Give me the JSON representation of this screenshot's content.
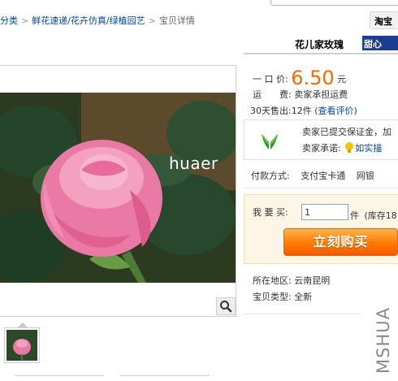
{
  "breadcrumb": {
    "items": [
      "分类",
      "鲜花速递/花卉仿真/绿植园艺",
      "宝贝详情"
    ],
    "separator": ">"
  },
  "search": {
    "tab_label": "淘宝 "
  },
  "shop": {
    "name": "花儿家玫瑰",
    "badge": "甜心 "
  },
  "product": {
    "image_watermark": "huaer",
    "price_label": "一 口 价:",
    "price": "6.50",
    "price_unit": "元",
    "shipping_label": "运　　费:",
    "shipping_value": "卖家承担运费",
    "sold_label": "30天售出:",
    "sold_value": "12件",
    "review_link": "(查看评价)",
    "deposit_text": "卖家已提交保证金，加",
    "promise_label": "卖家承诺:",
    "promise_link": "如实描",
    "payment_label": "付款方式:",
    "payment_alipay": "支付宝卡通",
    "payment_bank": "网银",
    "quantity_label": "我 要 买:",
    "quantity_value": "1",
    "quantity_unit": "件",
    "stock_text": "(库存18",
    "buy_button": "立刻购买",
    "location_label": "所在地区:",
    "location_value": "云南昆明",
    "type_label": "宝贝类型:",
    "type_value": "全新"
  },
  "watermark": "MSHUA",
  "colors": {
    "price": "#ff6600",
    "link": "#0046a6",
    "buy_button": "#ff7a00",
    "shop_badge": "#1c3d8f"
  }
}
